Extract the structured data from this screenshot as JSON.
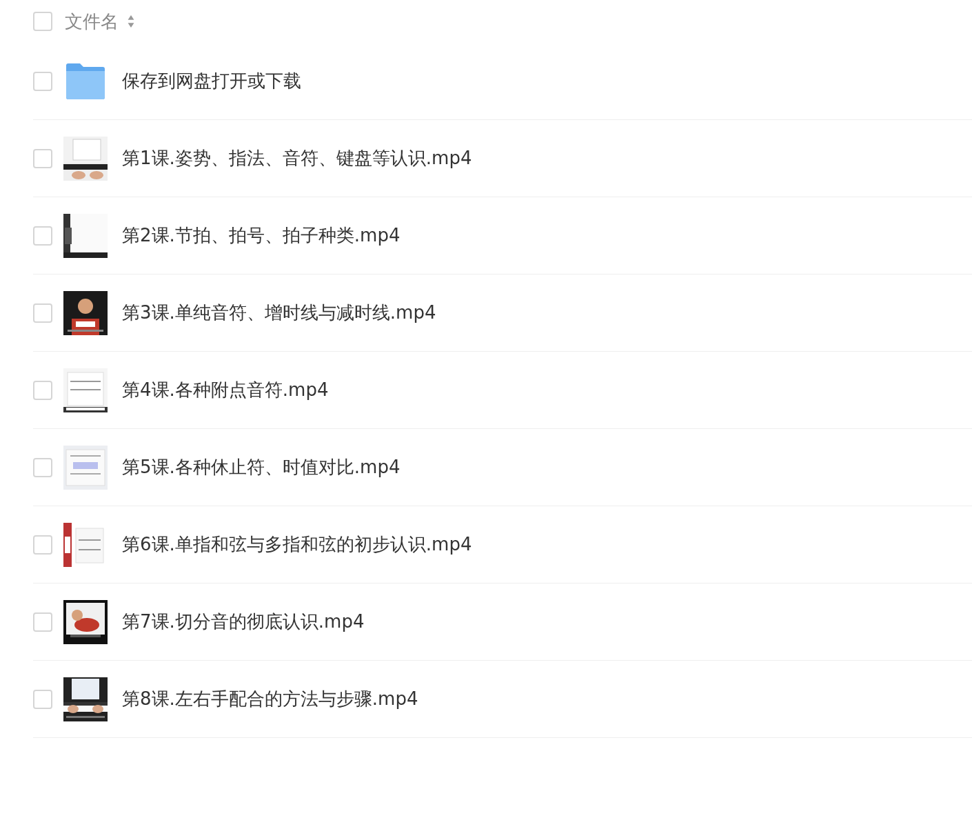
{
  "header": {
    "checked": false,
    "column_label": "文件名"
  },
  "files": [
    {
      "kind": "folder",
      "name": "保存到网盘打开或下载",
      "checked": false
    },
    {
      "kind": "video",
      "name": "第1课.姿势、指法、音符、键盘等认识.mp4",
      "checked": false
    },
    {
      "kind": "video",
      "name": "第2课.节拍、拍号、拍子种类.mp4",
      "checked": false
    },
    {
      "kind": "video",
      "name": "第3课.单纯音符、增时线与减时线.mp4",
      "checked": false
    },
    {
      "kind": "video",
      "name": "第4课.各种附点音符.mp4",
      "checked": false
    },
    {
      "kind": "video",
      "name": "第5课.各种休止符、时值对比.mp4",
      "checked": false
    },
    {
      "kind": "video",
      "name": "第6课.单指和弦与多指和弦的初步认识.mp4",
      "checked": false
    },
    {
      "kind": "video",
      "name": "第7课.切分音的彻底认识.mp4",
      "checked": false
    },
    {
      "kind": "video",
      "name": "第8课.左右手配合的方法与步骤.mp4",
      "checked": false
    }
  ]
}
